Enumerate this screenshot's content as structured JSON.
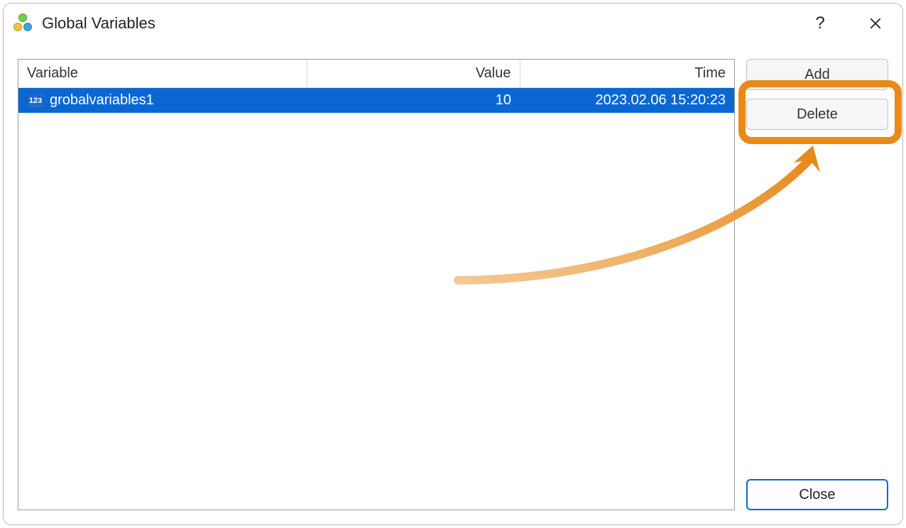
{
  "window": {
    "title": "Global Variables"
  },
  "table": {
    "headers": {
      "variable": "Variable",
      "value": "Value",
      "time": "Time"
    },
    "rows": [
      {
        "variable_icon_label": "123",
        "variable": "grobalvariables1",
        "value": "10",
        "time": "2023.02.06 15:20:23",
        "selected": true
      }
    ]
  },
  "buttons": {
    "add": "Add",
    "delete": "Delete",
    "close": "Close"
  }
}
